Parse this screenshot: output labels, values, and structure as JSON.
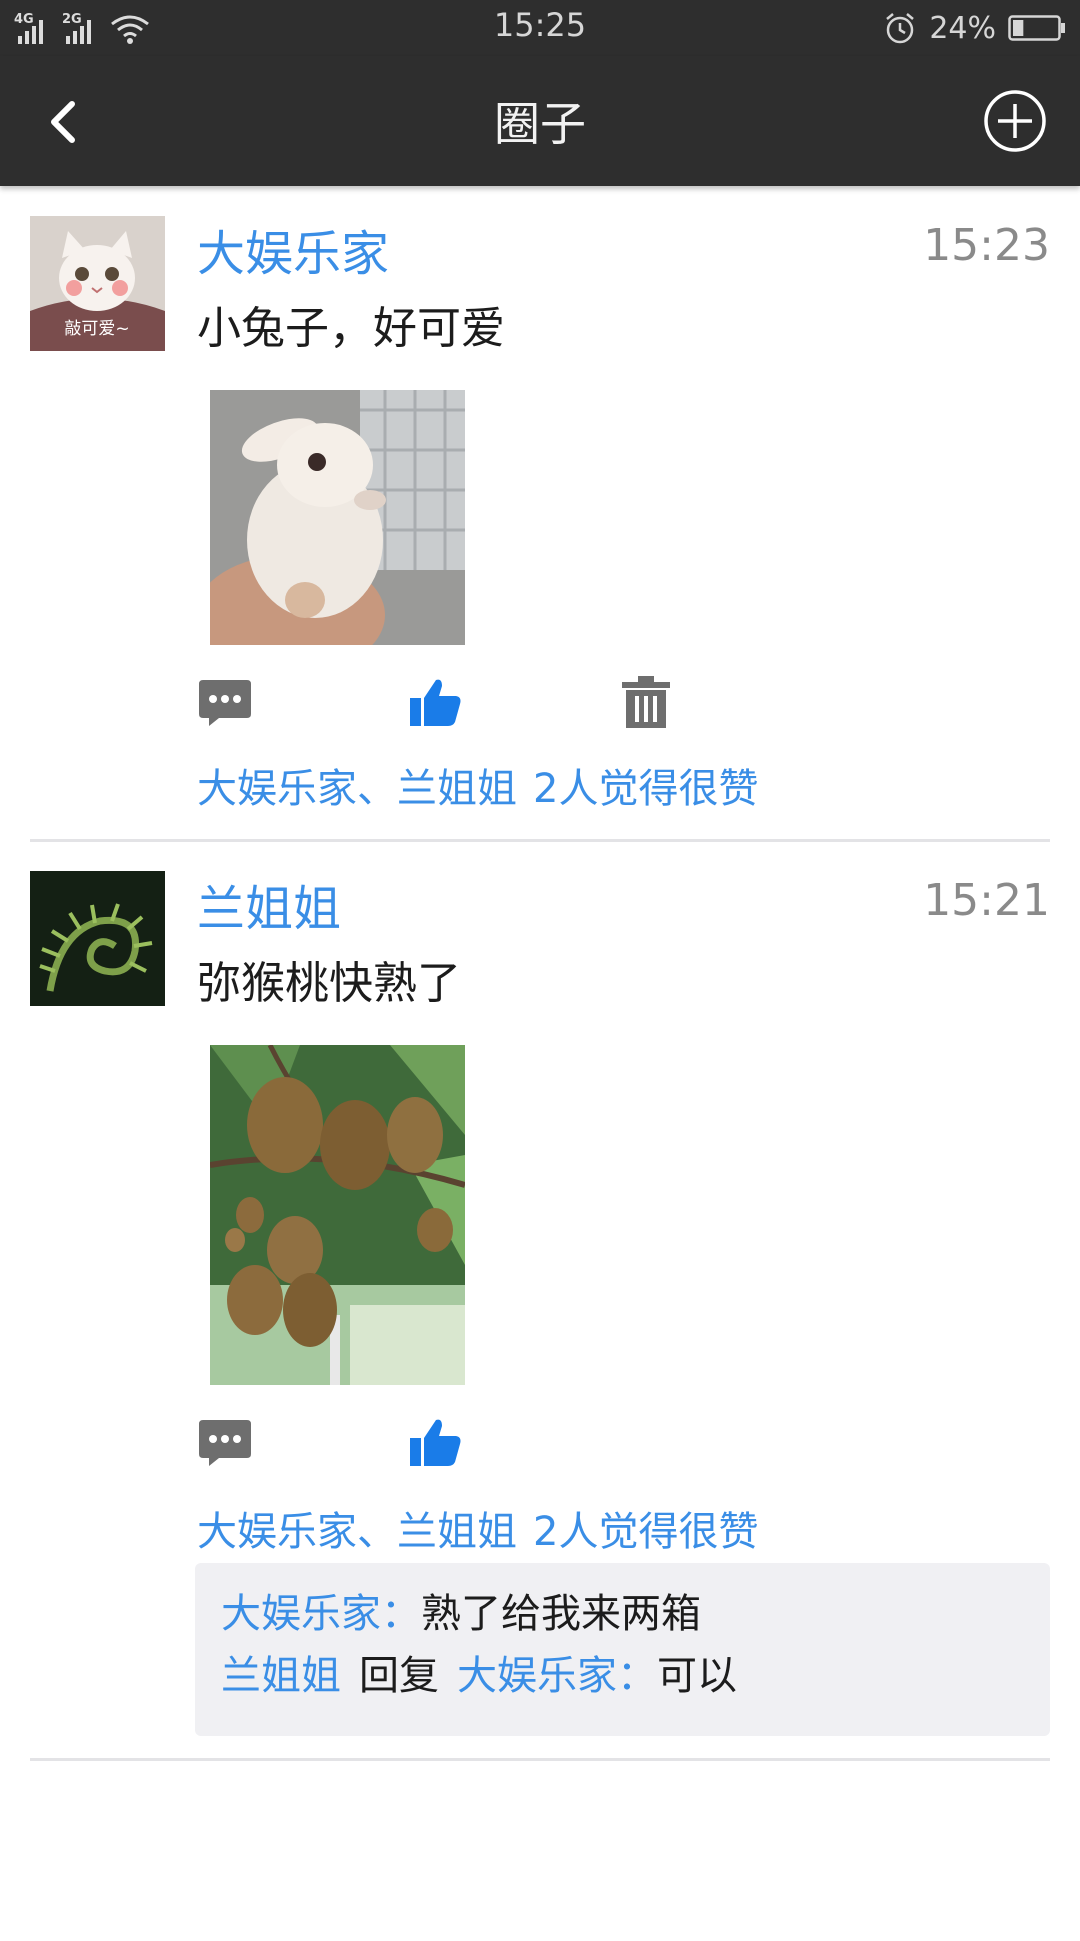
{
  "status_bar": {
    "net1": "4G",
    "net2": "2G",
    "time": "15:25",
    "battery": "24%",
    "battery_level": 0.24,
    "icons": [
      "signal-icon",
      "wifi-icon",
      "alarm-icon",
      "battery-icon"
    ]
  },
  "header": {
    "title": "圈子",
    "back_icon": "chevron-left-icon",
    "add_icon": "plus-circle-icon"
  },
  "posts": [
    {
      "user": "大娱乐家",
      "time": "15:23",
      "text": "小兔子，好可爱",
      "avatar_caption": "敲可爱~",
      "likes_names": "大娱乐家、兰姐姐",
      "likes_count": "2人觉得很赞",
      "actions": [
        "comment-icon",
        "like-icon",
        "delete-icon"
      ]
    },
    {
      "user": "兰姐姐",
      "time": "15:21",
      "text": "弥猴桃快熟了",
      "likes_names": "大娱乐家、兰姐姐",
      "likes_count": "2人觉得很赞",
      "actions": [
        "comment-icon",
        "like-icon"
      ],
      "comments": [
        {
          "user": "大娱乐家：",
          "text": "熟了给我来两箱"
        },
        {
          "user": "兰姐姐",
          "reply": "回复",
          "target": "大娱乐家：",
          "text": "可以"
        }
      ]
    }
  ],
  "colors": {
    "bar": "#2e2e2e",
    "link": "#3a8ee6",
    "like": "#1a7ce8",
    "icon_gray": "#6e6e6e",
    "comment_bg": "#f0f0f3"
  }
}
